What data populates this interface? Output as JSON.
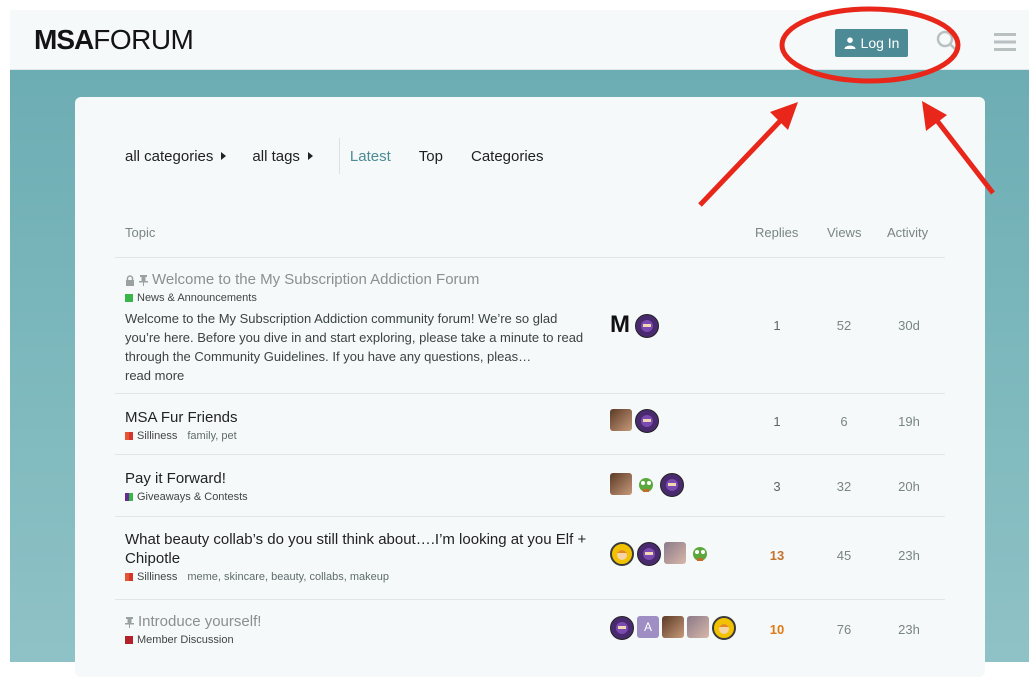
{
  "header": {
    "logo_bold": "MSA",
    "logo_rest": "FORUM",
    "login_label": "Log In",
    "search_icon": "search-icon",
    "menu_icon": "hamburger-icon"
  },
  "nav": {
    "categories": "all categories",
    "tags": "all tags",
    "tabs": [
      "Latest",
      "Top",
      "Categories"
    ],
    "active_tab": "Latest"
  },
  "table": {
    "headers": {
      "topic": "Topic",
      "replies": "Replies",
      "views": "Views",
      "activity": "Activity"
    },
    "rows": [
      {
        "title": "Welcome to the My Subscription Addiction Forum",
        "category": "News & Announcements",
        "category_color": "#3ab54a",
        "excerpt": "Welcome to the My Subscription Addiction community forum! We’re so glad you’re here. Before you dive in and start exploring, please take a minute to read through the Community Guidelines. If you have any questions, pleas…",
        "read_more": "read more",
        "replies": "1",
        "views": "52",
        "activity": "30d"
      },
      {
        "title": "MSA Fur Friends",
        "category": "Silliness",
        "category_color": "#e45735",
        "tags": [
          "family",
          "pet"
        ],
        "replies": "1",
        "views": "6",
        "activity": "19h"
      },
      {
        "title": "Pay it Forward!",
        "category": "Giveaways & Contests",
        "category_color": "#652d90",
        "replies": "3",
        "views": "32",
        "activity": "20h"
      },
      {
        "title_line1": "What beauty collab’s do you still think about….I’m looking at you Elf +",
        "title_line2": "Chipotle",
        "category": "Silliness",
        "category_color": "#e45735",
        "tags": [
          "meme",
          "skincare",
          "beauty",
          "collabs",
          "makeup"
        ],
        "replies": "13",
        "views": "45",
        "activity": "23h"
      },
      {
        "title": "Introduce yourself!",
        "category": "Member Discussion",
        "category_color": "#b3222a",
        "replies": "10",
        "views": "76",
        "activity": "23h",
        "poster_letter": "A"
      }
    ]
  },
  "colors": {
    "accent": "#4c8b95",
    "annotation_red": "#e8271a"
  }
}
